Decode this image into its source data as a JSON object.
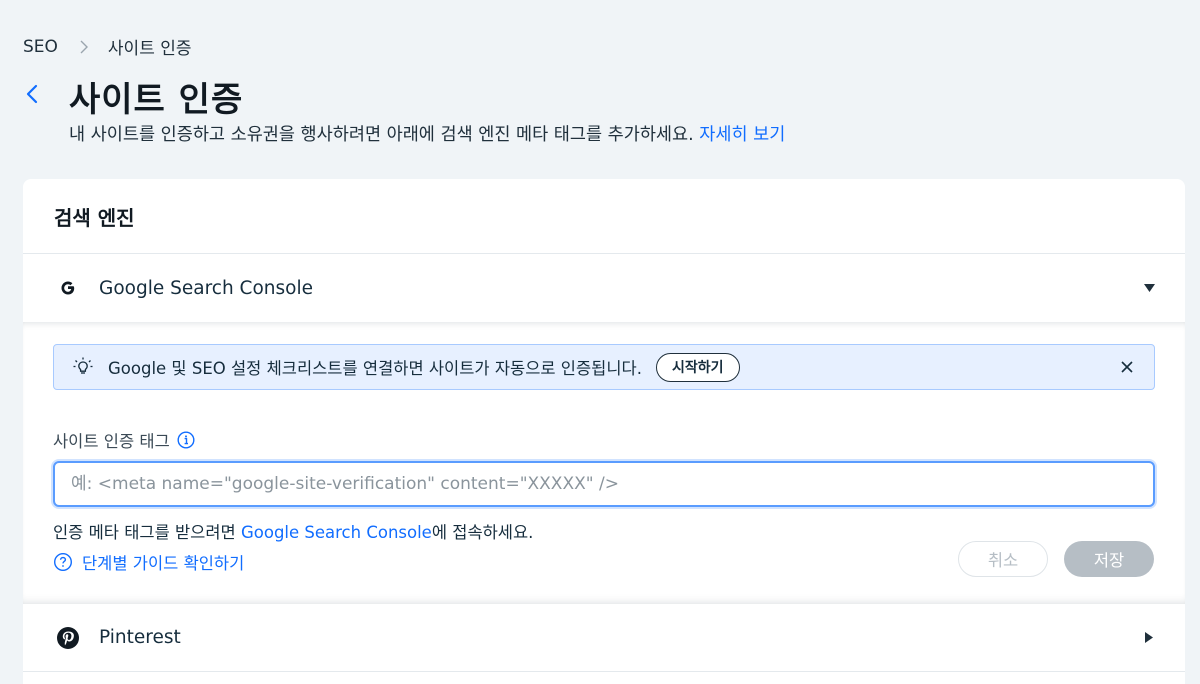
{
  "breadcrumb": {
    "root": "SEO",
    "current": "사이트 인증"
  },
  "header": {
    "title": "사이트 인증",
    "subtitle": "내 사이트를 인증하고 소유권을 행사하려면 아래에 검색 엔진 메타 태그를 추가하세요.",
    "learn_more": "자세히 보기"
  },
  "card": {
    "title": "검색 엔진",
    "google": {
      "label": "Google Search Console",
      "notice": {
        "text": "Google 및 SEO 설정 체크리스트를 연결하면 사이트가 자동으로 인증됩니다.",
        "button": "시작하기"
      },
      "field": {
        "label": "사이트 인증 태그",
        "placeholder": "예: <meta name=\"google-site-verification\" content=\"XXXXX\" />",
        "value": ""
      },
      "help": {
        "prefix": "인증 메타 태그를 받으려면 ",
        "link": "Google Search Console",
        "suffix": "에 접속하세요."
      },
      "guide_link": "단계별 가이드 확인하기",
      "cancel": "취소",
      "save": "저장"
    },
    "pinterest": {
      "label": "Pinterest"
    }
  },
  "colors": {
    "accent": "#116dff",
    "background": "#f0f4f7",
    "notice_bg": "#e7f0ff",
    "disabled": "#b6bec5"
  },
  "icons": {
    "breadcrumb_separator": "chevron-right-icon",
    "back": "chevron-left-icon",
    "google": "google-g-icon",
    "pinterest": "pinterest-icon",
    "expanded_toggle": "caret-down-icon",
    "collapsed_toggle": "caret-right-icon",
    "notice": "lightbulb-icon",
    "close": "close-icon",
    "info": "info-icon",
    "help": "question-circle-icon"
  }
}
